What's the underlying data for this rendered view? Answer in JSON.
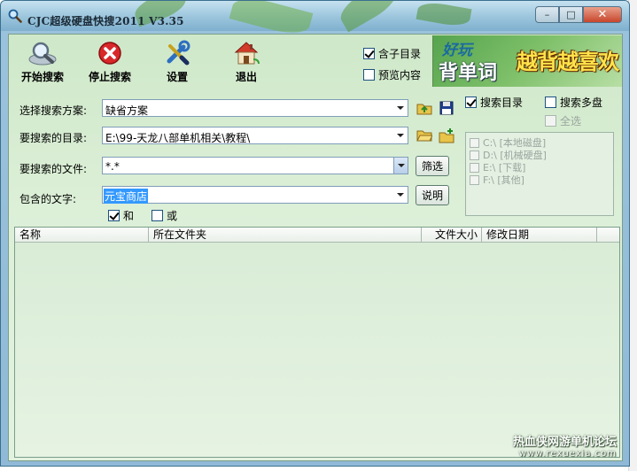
{
  "window": {
    "title": "CJC超级硬盘快搜2011 V3.35",
    "minimize_symbol": "–",
    "maximize_symbol": "□",
    "close_symbol": "✕"
  },
  "toolbar": {
    "start_label": "开始搜索",
    "stop_label": "停止搜索",
    "settings_label": "设置",
    "exit_label": "退出",
    "include_subdirs_label": "含子目录",
    "include_subdirs_checked": true,
    "preview_label": "预览内容",
    "preview_checked": false
  },
  "banner": {
    "line1": "好玩",
    "line2": "背单词",
    "line3": "越背越喜欢"
  },
  "form": {
    "scheme_label": "选择搜索方案:",
    "scheme_value": "缺省方案",
    "dir_label": "要搜索的目录:",
    "dir_value": "E:\\99-天龙八部单机相关\\教程\\",
    "file_label": "要搜索的文件:",
    "file_value": "*.*",
    "filter_button": "筛选",
    "text_label": "包含的文字:",
    "text_value": "元宝商店",
    "explain_button": "说明",
    "and_label": "和",
    "and_checked": true,
    "or_label": "或",
    "or_checked": false
  },
  "right_panel": {
    "search_dir_label": "搜索目录",
    "search_dir_checked": true,
    "multi_disk_label": "搜索多盘",
    "multi_disk_checked": false,
    "select_all_label": "全选",
    "drives": [
      "C:\\ [本地磁盘]",
      "D:\\ [机械硬盘]",
      "E:\\ [下载]",
      "F:\\ [其他]"
    ]
  },
  "results": {
    "columns": [
      "名称",
      "所在文件夹",
      "文件大小",
      "修改日期"
    ],
    "rows": []
  },
  "watermark": {
    "line1": "热血侠网游单机论坛",
    "line2": "www.rexuexia.com"
  },
  "colors": {
    "client_bg": "#dcefd7",
    "title_bar": "#9ac4dc",
    "close_button": "#c8452c",
    "selection": "#3399ff"
  }
}
